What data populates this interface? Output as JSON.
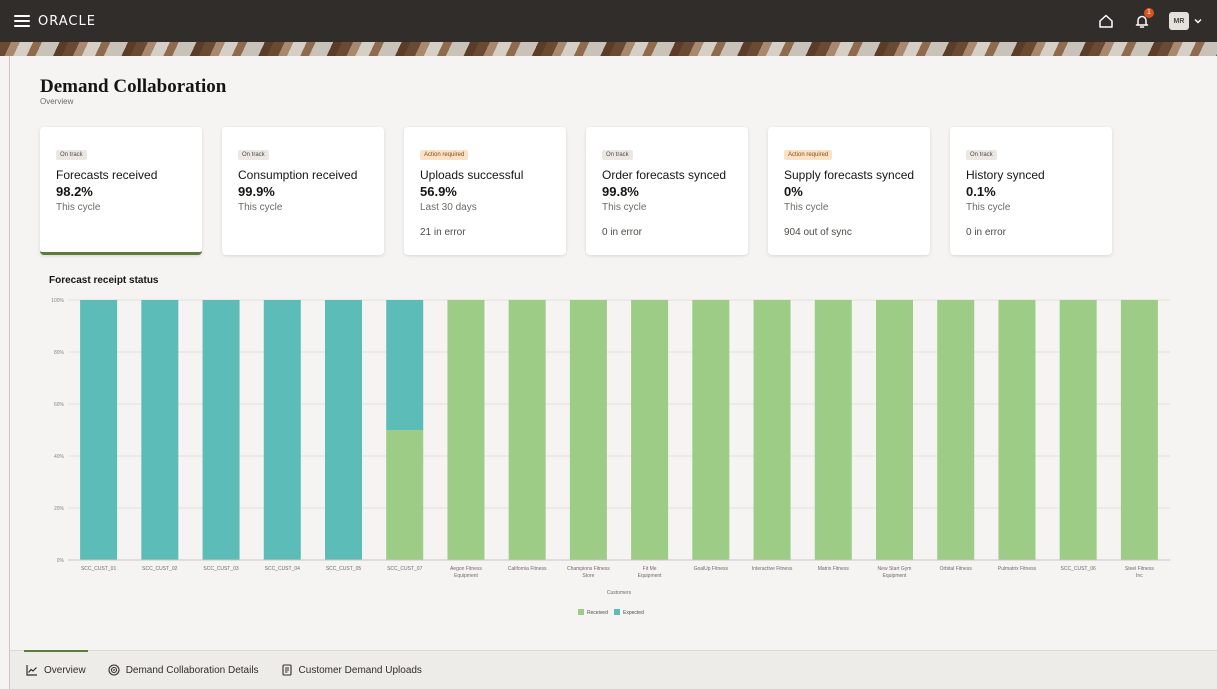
{
  "header": {
    "logo": "ORACLE",
    "avatar_initials": "MR",
    "notification_count": "1",
    "icons": [
      "menu-icon",
      "home-icon",
      "bell-icon",
      "chevron-down-icon"
    ]
  },
  "page": {
    "title": "Demand Collaboration",
    "subtitle": "Overview"
  },
  "cards": [
    {
      "status": "On track",
      "label": "Forecasts received",
      "value": "98.2%",
      "period": "This cycle",
      "detail": ""
    },
    {
      "status": "On track",
      "label": "Consumption received",
      "value": "99.9%",
      "period": "This cycle",
      "detail": ""
    },
    {
      "status": "Action required",
      "label": "Uploads successful",
      "value": "56.9%",
      "period": "Last 30 days",
      "detail": "21 in error"
    },
    {
      "status": "On track",
      "label": "Order forecasts synced",
      "value": "99.8%",
      "period": "This cycle",
      "detail": "0 in error"
    },
    {
      "status": "Action required",
      "label": "Supply forecasts synced",
      "value": "0%",
      "period": "This cycle",
      "detail": "904 out of sync"
    },
    {
      "status": "On track",
      "label": "History synced",
      "value": "0.1%",
      "period": "This cycle",
      "detail": "0 in error"
    }
  ],
  "colors": {
    "received": "#9ccc86",
    "expected": "#5cbcb8",
    "warning_pill": "#fbe2c6",
    "accent": "#5a7d3a"
  },
  "chart_data": {
    "type": "bar",
    "stacked": true,
    "title": "Forecast receipt status",
    "xlabel": "Customers",
    "ylabel": "",
    "ylim": [
      0,
      100
    ],
    "yticks": [
      "0%",
      "20%",
      "40%",
      "60%",
      "80%",
      "100%"
    ],
    "categories": [
      "SCC_CUST_01",
      "SCC_CUST_02",
      "SCC_CUST_03",
      "SCC_CUST_04",
      "SCC_CUST_05",
      "SCC_CUST_07",
      "Aegon Fitness Equipment",
      "California Fitness",
      "Champions Fitness Store",
      "Fit Me Equipment",
      "GoalUp Fitness",
      "Interactive Fitness",
      "Matrix Fitness",
      "New Start Gym Equipment",
      "Orbital Fitness",
      "Pulmatrix Fitness",
      "SCC_CUST_06",
      "Steel Fitness Inc"
    ],
    "series": [
      {
        "name": "Received",
        "values": [
          0,
          0,
          0,
          0,
          0,
          50,
          100,
          100,
          100,
          100,
          100,
          100,
          100,
          100,
          100,
          100,
          100,
          100
        ]
      },
      {
        "name": "Expected",
        "values": [
          100,
          100,
          100,
          100,
          100,
          50,
          0,
          0,
          0,
          0,
          0,
          0,
          0,
          0,
          0,
          0,
          0,
          0
        ]
      }
    ],
    "legend": "bottom",
    "grid": true
  },
  "bottom_tabs": [
    {
      "label": "Overview",
      "icon": "line-chart-icon"
    },
    {
      "label": "Demand Collaboration Details",
      "icon": "target-icon"
    },
    {
      "label": "Customer Demand Uploads",
      "icon": "document-icon"
    }
  ]
}
